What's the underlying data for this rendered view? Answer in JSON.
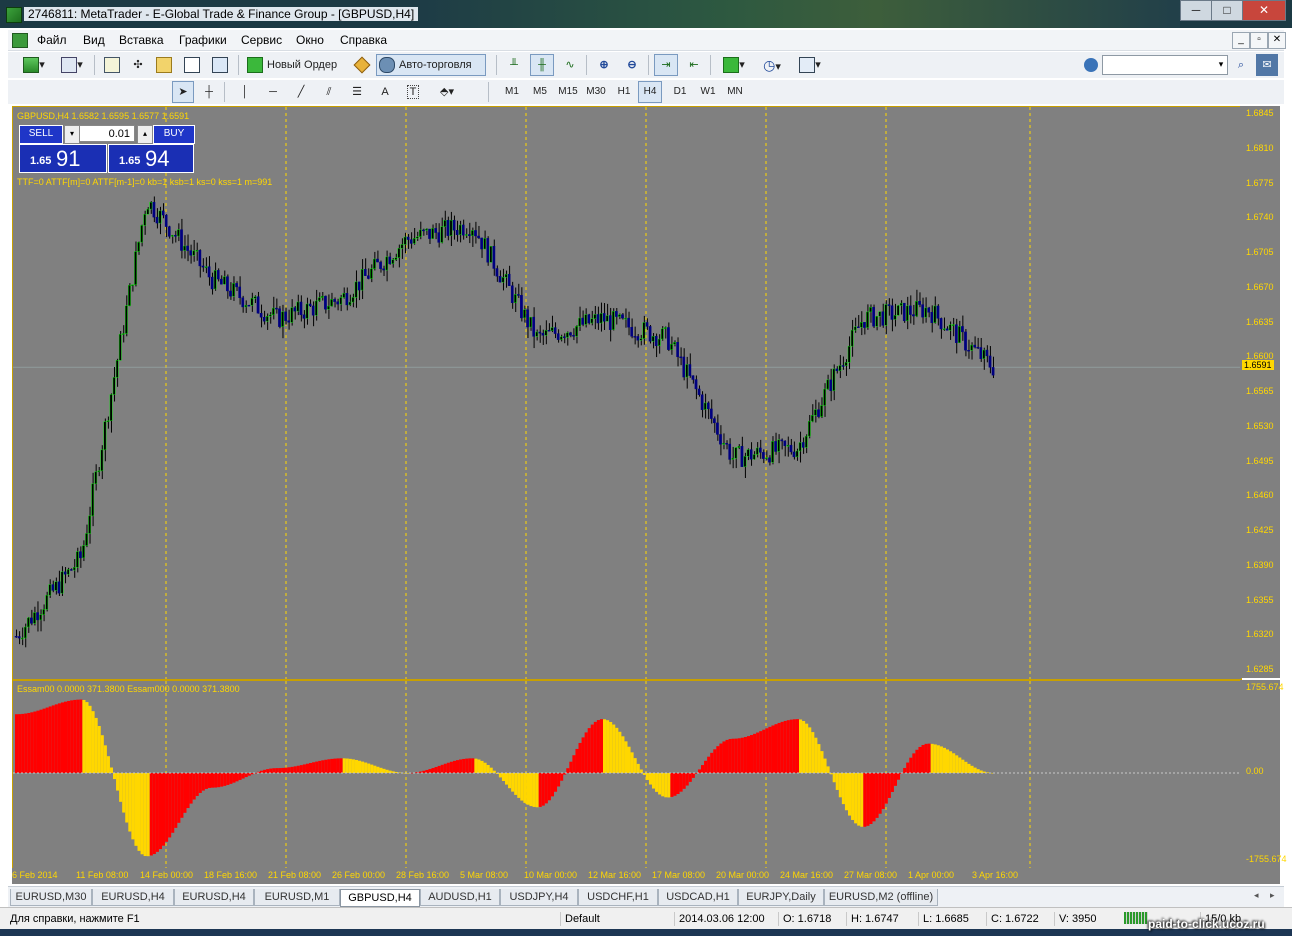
{
  "window": {
    "title": "2746811: MetaTrader - E-Global Trade & Finance Group - [GBPUSD,H4]",
    "minimize": "─",
    "maximize": "□",
    "close": "✕"
  },
  "menu": {
    "items": [
      "Файл",
      "Вид",
      "Вставка",
      "Графики",
      "Сервис",
      "Окно",
      "Справка"
    ],
    "mdi_minimize": "_",
    "mdi_restore": "▫",
    "mdi_close": "✕"
  },
  "toolbar": {
    "new_order": "Новый Ордер",
    "autotrading": "Авто-торговля",
    "search_placeholder": ""
  },
  "drawing_tools": {
    "text_tool": "A",
    "label_tool": "T",
    "timeframes": [
      "M1",
      "M5",
      "M15",
      "M30",
      "H1",
      "H4",
      "D1",
      "W1",
      "MN"
    ],
    "active_timeframe": "H4"
  },
  "chart": {
    "symbol_header": "GBPUSD,H4  1.6582 1.6595 1.6577 1.6591",
    "indicator_text": "TTF=0 ATTF[m]=0 ATTF[m-1]=0 kb=1 ksb=1 ks=0 kss=1 m=991",
    "oneclick": {
      "sell": "SELL",
      "buy": "BUY",
      "lot": "0.01",
      "bid_small": "1.65",
      "bid_big": "91",
      "ask_small": "1.65",
      "ask_big": "94"
    },
    "price_labels": [
      "1.6845",
      "1.6810",
      "1.6775",
      "1.6740",
      "1.6705",
      "1.6670",
      "1.6635",
      "1.6600",
      "1.6565",
      "1.6530",
      "1.6495",
      "1.6460",
      "1.6425",
      "1.6390",
      "1.6355",
      "1.6320",
      "1.6285"
    ],
    "current_price": "1.6591",
    "time_labels": [
      "6 Feb 2014",
      "11 Feb 08:00",
      "14 Feb 00:00",
      "18 Feb 16:00",
      "21 Feb 08:00",
      "26 Feb 00:00",
      "28 Feb 16:00",
      "5 Mar 08:00",
      "10 Mar 00:00",
      "12 Mar 16:00",
      "17 Mar 08:00",
      "20 Mar 00:00",
      "24 Mar 16:00",
      "27 Mar 08:00",
      "1 Apr 00:00",
      "3 Apr 16:00"
    ],
    "colors": {
      "background": "#808080",
      "bull": "#00ff00",
      "bear": "#000080",
      "grid": "#ffd700",
      "red": "#ff0000",
      "yellow": "#ffd700"
    }
  },
  "oscillator": {
    "legend": "Essam00 0.0000 371.3800  Essam000 0.0000 371.3800",
    "max_label": "1755.674",
    "zero_label": "0.00",
    "min_label": "-1755.674"
  },
  "chart_data": {
    "type": "line",
    "title": "GBPUSD,H4",
    "x": [
      "6 Feb 2014",
      "11 Feb 08:00",
      "14 Feb 00:00",
      "18 Feb 16:00",
      "21 Feb 08:00",
      "26 Feb 00:00",
      "28 Feb 16:00",
      "5 Mar 08:00",
      "10 Mar 00:00",
      "12 Mar 16:00",
      "17 Mar 08:00",
      "20 Mar 00:00",
      "24 Mar 16:00",
      "27 Mar 08:00",
      "1 Apr 00:00",
      "3 Apr 16:00"
    ],
    "series": [
      {
        "values": [
          1.632,
          1.64,
          1.676,
          1.668,
          1.664,
          1.666,
          1.672,
          1.6735,
          1.662,
          1.664,
          1.662,
          1.65,
          1.651,
          1.664,
          1.665,
          1.6591
        ]
      }
    ],
    "ylim": [
      1.6285,
      1.6845
    ],
    "osc_series": [
      {
        "values": [
          1200,
          1500,
          -1700,
          -300,
          100,
          300,
          0,
          300,
          -700,
          1100,
          -500,
          700,
          1100,
          -1100,
          600,
          0
        ]
      }
    ],
    "osc_ylim": [
      -1755.674,
      1755.674
    ]
  },
  "tabs": {
    "items": [
      "EURUSD,M30",
      "EURUSD,H4",
      "EURUSD,H4",
      "EURUSD,M1",
      "GBPUSD,H4",
      "AUDUSD,H1",
      "USDJPY,H4",
      "USDCHF,H1",
      "USDCAD,H1",
      "EURJPY,Daily",
      "EURUSD,M2 (offline)"
    ],
    "active": 4
  },
  "status": {
    "help": "Для справки, нажмите F1",
    "profile": "Default",
    "datetime": "2014.03.06 12:00",
    "open": "O: 1.6718",
    "high": "H: 1.6747",
    "low": "L: 1.6685",
    "close": "C: 1.6722",
    "volume": "V: 3950",
    "traffic": "15/0 kb"
  },
  "watermark": "paid-to-click.ucoz.ru"
}
